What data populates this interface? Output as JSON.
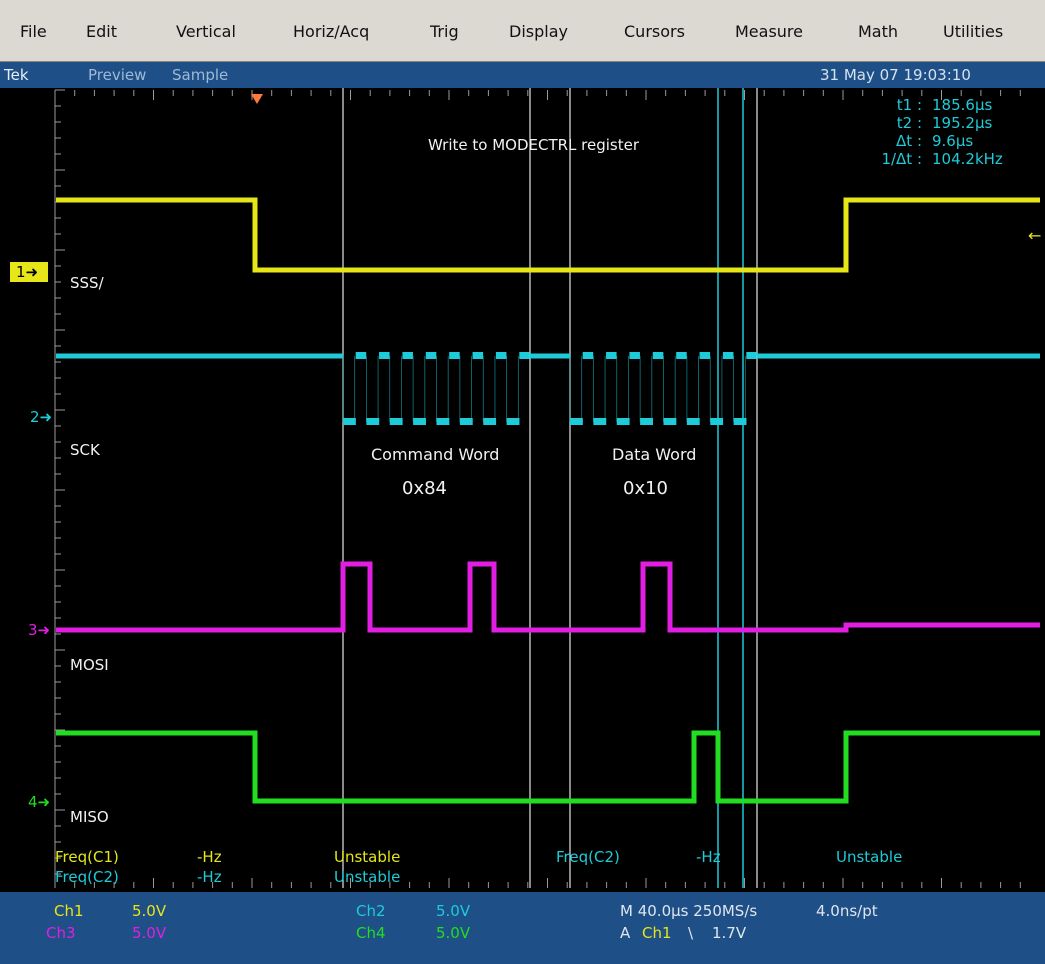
{
  "menu": {
    "items": [
      "File",
      "Edit",
      "Vertical",
      "Horiz/Acq",
      "Trig",
      "Display",
      "Cursors",
      "Measure",
      "Math",
      "Utilities"
    ]
  },
  "status": {
    "brand": "Tek",
    "mode": "Preview",
    "acq": "Sample",
    "datetime": "31 May 07 19:03:10"
  },
  "cursor_readout": {
    "t1_label": "t1 :",
    "t1_value": "185.6µs",
    "t2_label": "t2 :",
    "t2_value": "195.2µs",
    "dt_label": "Δt :",
    "dt_value": "9.6µs",
    "inv_label": "1/Δt :",
    "inv_value": "104.2kHz"
  },
  "annotations": {
    "title": "Write to MODECTRL register",
    "command_word": "Command Word",
    "command_value": "0x84",
    "data_word": "Data Word",
    "data_value": "0x10"
  },
  "channels": [
    {
      "marker": "1",
      "name": "SSS/",
      "color": "#e6e619"
    },
    {
      "marker": "2",
      "name": "SCK",
      "color": "#1ecbd8"
    },
    {
      "marker": "3",
      "name": "MOSI",
      "color": "#e21ee2"
    },
    {
      "marker": "4",
      "name": "MISO",
      "color": "#22dd22"
    }
  ],
  "measurements": {
    "row1": [
      "Freq(C1)",
      "-Hz",
      "Unstable",
      "Freq(C2)",
      "-Hz",
      "Unstable"
    ],
    "row2": [
      "Freq(C2)",
      "-Hz",
      "Unstable"
    ]
  },
  "bottom": {
    "ch1_label": "Ch1",
    "ch1_scale": "5.0V",
    "ch3_label": "Ch3",
    "ch3_scale": "5.0V",
    "ch2_label": "Ch2",
    "ch2_scale": "5.0V",
    "ch4_label": "Ch4",
    "ch4_scale": "5.0V",
    "horiz": "M 40.0µs 250MS/s",
    "resolution": "4.0ns/pt",
    "trig_a": "A",
    "trig_ch": "Ch1",
    "trig_slope": "\\",
    "trig_level": "1.7V"
  },
  "colors": {
    "menubar_bg": "#dcd8d2",
    "status_bg": "#1e4f86",
    "screen_bg": "#000000",
    "grid": "#9a9a9a",
    "cursor_lines": "#ffffff",
    "ch1": "#e6e619",
    "ch2": "#1ecbd8",
    "ch3": "#e21ee2",
    "ch4": "#22dd22",
    "trigger_marker": "#ff7a3c"
  }
}
